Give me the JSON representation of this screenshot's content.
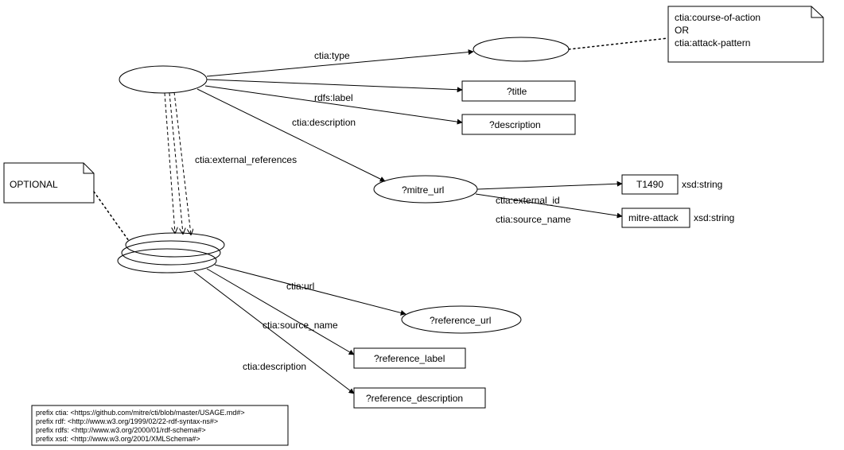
{
  "edges": {
    "type": "ctia:type",
    "label": "rdfs:label",
    "description": "ctia:description",
    "external_references": "ctia:external_references",
    "external_id": "ctia:external_id",
    "source_name": "ctia:source_name",
    "url": "ctia:url",
    "source_name2": "ctia:source_name",
    "description2": "ctia:description"
  },
  "nodes": {
    "title": "?title",
    "description": "?description",
    "mitre_url": "?mitre_url",
    "t1490": "T1490",
    "mitre_attack": "mitre-attack",
    "reference_url": "?reference_url",
    "reference_label": "?reference_label",
    "reference_description": "?reference_description"
  },
  "types": {
    "xsd_string1": "xsd:string",
    "xsd_string2": "xsd:string"
  },
  "notes": {
    "optional": "OPTIONAL",
    "type_note_l1": "ctia:course-of-action",
    "type_note_l2": "OR",
    "type_note_l3": "ctia:attack-pattern"
  },
  "prefixes": {
    "p1": "prefix ctia:  <https://github.com/mitre/cti/blob/master/USAGE.md#>",
    "p2": "prefix rdf:   <http://www.w3.org/1999/02/22-rdf-syntax-ns#>",
    "p3": "prefix rdfs:  <http://www.w3.org/2000/01/rdf-schema#>",
    "p4": "prefix xsd:   <http://www.w3.org/2001/XMLSchema#>"
  }
}
